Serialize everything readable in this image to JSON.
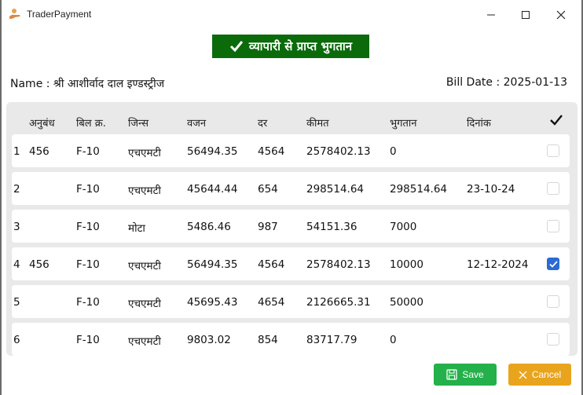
{
  "window": {
    "title": "TraderPayment"
  },
  "heading": {
    "text": "व्यापारी से प्राप्त भुगतान"
  },
  "info": {
    "name": "Name : श्री आशीर्वाद दाल इण्डस्ट्रीज",
    "bill_date": "Bill Date : 2025-01-13"
  },
  "table": {
    "columns": [
      "अनुबंध",
      "बिल क्र.",
      "जिन्स",
      "वजन",
      "दर",
      "कीमत",
      "भुगतान",
      "दिनांक"
    ],
    "rows": [
      {
        "sn": "1",
        "contract": "456",
        "bill": "F-10",
        "item": "एचएमटी",
        "weight": "56494.35",
        "rate": "4564",
        "amount": "2578402.13",
        "paid": "0",
        "date": "",
        "checked": false
      },
      {
        "sn": "2",
        "contract": "",
        "bill": "F-10",
        "item": "एचएमटी",
        "weight": "45644.44",
        "rate": "654",
        "amount": "298514.64",
        "paid": "298514.64",
        "date": "23-10-24",
        "checked": false
      },
      {
        "sn": "3",
        "contract": "",
        "bill": "F-10",
        "item": "मोटा",
        "weight": "5486.46",
        "rate": "987",
        "amount": "54151.36",
        "paid": "7000",
        "date": "",
        "checked": false
      },
      {
        "sn": "4",
        "contract": "456",
        "bill": "F-10",
        "item": "एचएमटी",
        "weight": "56494.35",
        "rate": "4564",
        "amount": "2578402.13",
        "paid": "10000",
        "date": "12-12-2024",
        "checked": true
      },
      {
        "sn": "5",
        "contract": "",
        "bill": "F-10",
        "item": "एचएमटी",
        "weight": "45695.43",
        "rate": "4654",
        "amount": "2126665.31",
        "paid": "50000",
        "date": "",
        "checked": false
      },
      {
        "sn": "6",
        "contract": "",
        "bill": "F-10",
        "item": "एचएमटी",
        "weight": "9803.02",
        "rate": "854",
        "amount": "83717.79",
        "paid": "0",
        "date": "",
        "checked": false
      }
    ]
  },
  "buttons": {
    "save": "Save",
    "cancel": "Cancel"
  }
}
